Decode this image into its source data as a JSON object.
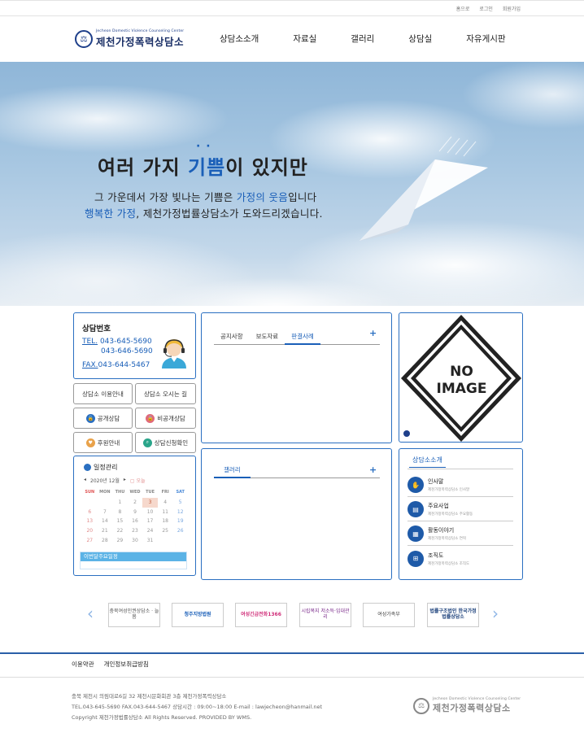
{
  "top_links": [
    "홈으로",
    "로그인",
    "회원가입"
  ],
  "logo": {
    "subtitle": "Jecheon Domestic Violence Counseling Center",
    "name": "제천가정폭력상담소"
  },
  "nav": [
    "상담소소개",
    "자료실",
    "갤러리",
    "상담실",
    "자유게시판"
  ],
  "hero": {
    "title_pre": "여러 가지 ",
    "title_highlight": "기쁨",
    "title_post": "이 있지만",
    "line1_pre": "그 가운데서 가장 빛나는 기쁨은 ",
    "line1_highlight": "가정의 웃음",
    "line1_post": "입니다",
    "line2_highlight": "행복한 가정",
    "line2_post": ", 제천가정법률상담소가 도와드리겠습니다."
  },
  "contact": {
    "title": "상담번호",
    "tel_label": "TEL.",
    "tel1": "043-645-5690",
    "tel2": "043-646-5690",
    "fax_label": "FAX.",
    "fax": "043-644-5467"
  },
  "quick_buttons": {
    "guide": "상담소 이용안내",
    "directions": "상담소 오시는 길",
    "public": "공개상담",
    "private": "비공개상담",
    "sponsor": "후원안내",
    "check": "상담신청확인"
  },
  "calendar": {
    "title": "일정관리",
    "prev": "◂",
    "month": "2020년 12월",
    "next": "▸",
    "today": "오늘",
    "weekdays": [
      "SUN",
      "MON",
      "THU",
      "WED",
      "TUE",
      "FRI",
      "SAT"
    ],
    "weeks": [
      [
        "",
        "",
        "1",
        "2",
        "3",
        "4",
        "5"
      ],
      [
        "6",
        "7",
        "8",
        "9",
        "10",
        "11",
        "12"
      ],
      [
        "13",
        "14",
        "15",
        "16",
        "17",
        "18",
        "19"
      ],
      [
        "20",
        "21",
        "22",
        "23",
        "24",
        "25",
        "26"
      ],
      [
        "27",
        "28",
        "29",
        "30",
        "31",
        "",
        ""
      ]
    ],
    "schedule_title": "이번달주요일정"
  },
  "notice": {
    "tabs": [
      "공지사항",
      "보도자료",
      "판결사례"
    ],
    "active_tab": "판결사례",
    "more": "+"
  },
  "gallery": {
    "title": "갤러리",
    "more": "+"
  },
  "noimage": {
    "line1": "NO",
    "line2": "IMAGE"
  },
  "intro": {
    "title": "상담소소개",
    "items": [
      {
        "name": "인사말",
        "desc": "제천가정폭력상담소 인사말",
        "icon": "handshake-icon"
      },
      {
        "name": "주요사업",
        "desc": "제천가정폭력상담소 주요활동",
        "icon": "document-icon"
      },
      {
        "name": "활동이야기",
        "desc": "제천가정폭력상담소 연혁",
        "icon": "calendar-icon"
      },
      {
        "name": "조직도",
        "desc": "제천가정폭력상담소 조직도",
        "icon": "org-chart-icon"
      }
    ]
  },
  "banners": [
    {
      "text": "충북여성인권상담소 · 늘봄",
      "color": "#555555"
    },
    {
      "text": "청주지방법원",
      "color": "#1a5fb8"
    },
    {
      "text": "여성긴급전화1366",
      "color": "#d0307a"
    },
    {
      "text": "시립복지 저소득·임대관리",
      "color": "#7a2a8a"
    },
    {
      "text": "여성가족부",
      "color": "#444444"
    },
    {
      "text": "법률구조법인 한국가정법률상담소",
      "color": "#1a3f7a"
    }
  ],
  "footer": {
    "links": [
      "이용약관",
      "개인정보취급방침"
    ],
    "address": "충북 제천시 의림대로6길 32 제천시문화회관 3층 제천가정폭력상담소",
    "contact": "TEL.043-645-5690    FAX.043-644-5467    상담시간 : 09:00~18:00    E-mail : lawjecheon@hanmail.net",
    "copyright": "Copyright 제천가정법률상담소 All Rights Reserved. PROVIDED BY WMS.",
    "logo_subtitle": "Jecheon Domestic Violence Counseling Center",
    "logo_name": "제천가정폭력상담소"
  },
  "colors": {
    "brand": "#1a5fb8",
    "border": "#2a6fc1",
    "footer_line": "#2a5fa8"
  }
}
